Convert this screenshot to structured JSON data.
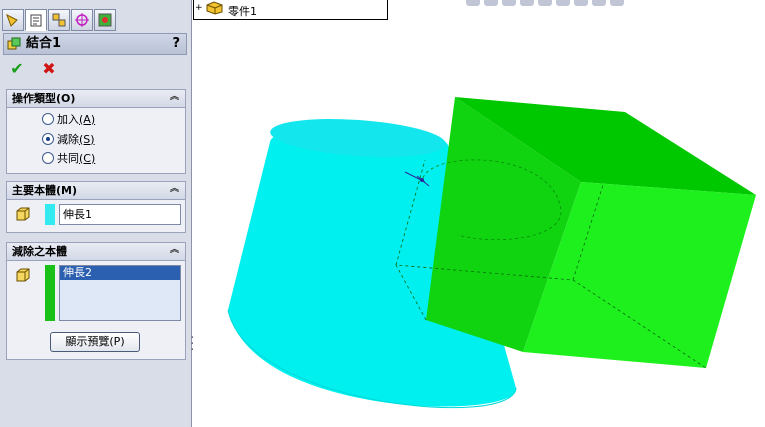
{
  "property_manager": {
    "tabs": [
      "feature-manager-icon",
      "property-manager-icon",
      "configuration-manager-icon",
      "dimxpert-icon",
      "display-manager-icon"
    ],
    "title": "結合1",
    "help": "?",
    "ok_label": "✔",
    "cancel_label": "✖",
    "operation_group": {
      "title": "操作類型(O)",
      "options": [
        {
          "label": "加入",
          "key": "(A)",
          "checked": false
        },
        {
          "label": "減除",
          "key": "(S)",
          "checked": true
        },
        {
          "label": "共同",
          "key": "(C)",
          "checked": false
        }
      ]
    },
    "main_body_group": {
      "title": "主要本體(M)",
      "item": "伸長1",
      "color": "#33eaf0"
    },
    "subtract_group": {
      "title": "減除之本體",
      "item": "伸長2",
      "color": "#18c018",
      "preview_button": "顯示預覽(P)"
    }
  },
  "feature_tree": {
    "expander": "+",
    "part_label": "零件1"
  },
  "colors": {
    "cylinder": "#00f0f0",
    "box_front": "#1ef01e",
    "box_top": "#00c800",
    "box_side": "#0fd40f"
  }
}
